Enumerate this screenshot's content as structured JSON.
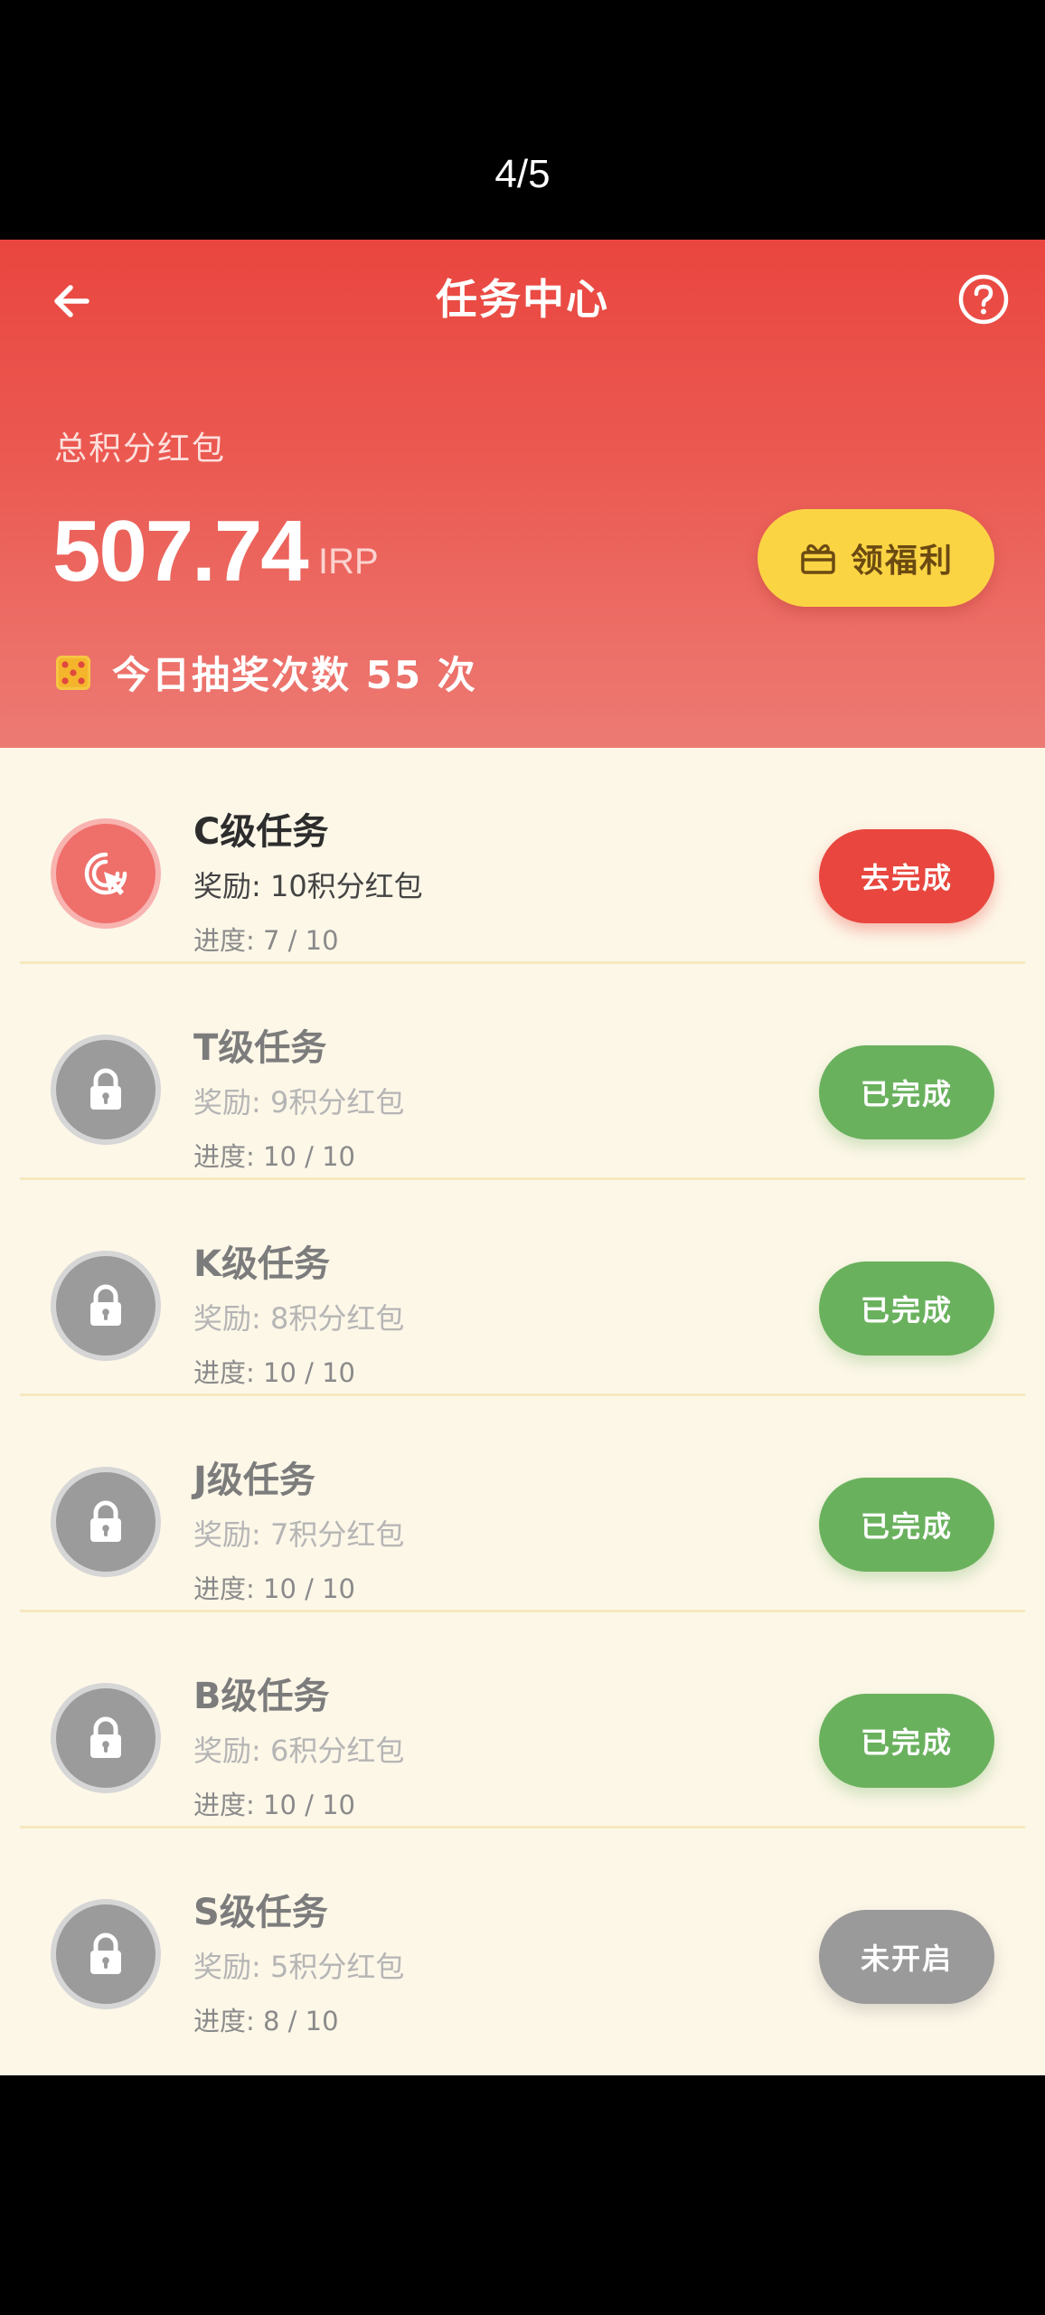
{
  "viewer": {
    "page_counter": "4/5"
  },
  "header": {
    "title": "任务中心",
    "total_label": "总积分红包",
    "total_amount": "507.74",
    "total_unit": "IRP",
    "welfare_button": "领福利",
    "draws_text": "今日抽奖次数 55 次"
  },
  "colors": {
    "header_red": "#e9463f",
    "go_red": "#e8463e",
    "done_green": "#6ab15e",
    "closed_gray": "#9a9a9a",
    "welfare_yellow": "#fbd443",
    "list_bg": "#fdf7e8"
  },
  "icons": {
    "back": "arrow-left-icon",
    "help": "question-circle-icon",
    "gift": "gift-icon",
    "dice": "dice-icon",
    "active_task": "pointer-target-icon",
    "locked_task": "lock-icon"
  },
  "tasks": [
    {
      "name": "C级任务",
      "reward": "奖励: 10积分红包",
      "progress": "进度: 7 / 10",
      "action": "去完成",
      "state": "active"
    },
    {
      "name": "T级任务",
      "reward": "奖励: 9积分红包",
      "progress": "进度: 10 / 10",
      "action": "已完成",
      "state": "done"
    },
    {
      "name": "K级任务",
      "reward": "奖励: 8积分红包",
      "progress": "进度: 10 / 10",
      "action": "已完成",
      "state": "done"
    },
    {
      "name": "J级任务",
      "reward": "奖励: 7积分红包",
      "progress": "进度: 10 / 10",
      "action": "已完成",
      "state": "done"
    },
    {
      "name": "B级任务",
      "reward": "奖励: 6积分红包",
      "progress": "进度: 10 / 10",
      "action": "已完成",
      "state": "done"
    },
    {
      "name": "S级任务",
      "reward": "奖励: 5积分红包",
      "progress": "进度: 8 / 10",
      "action": "未开启",
      "state": "off"
    }
  ]
}
